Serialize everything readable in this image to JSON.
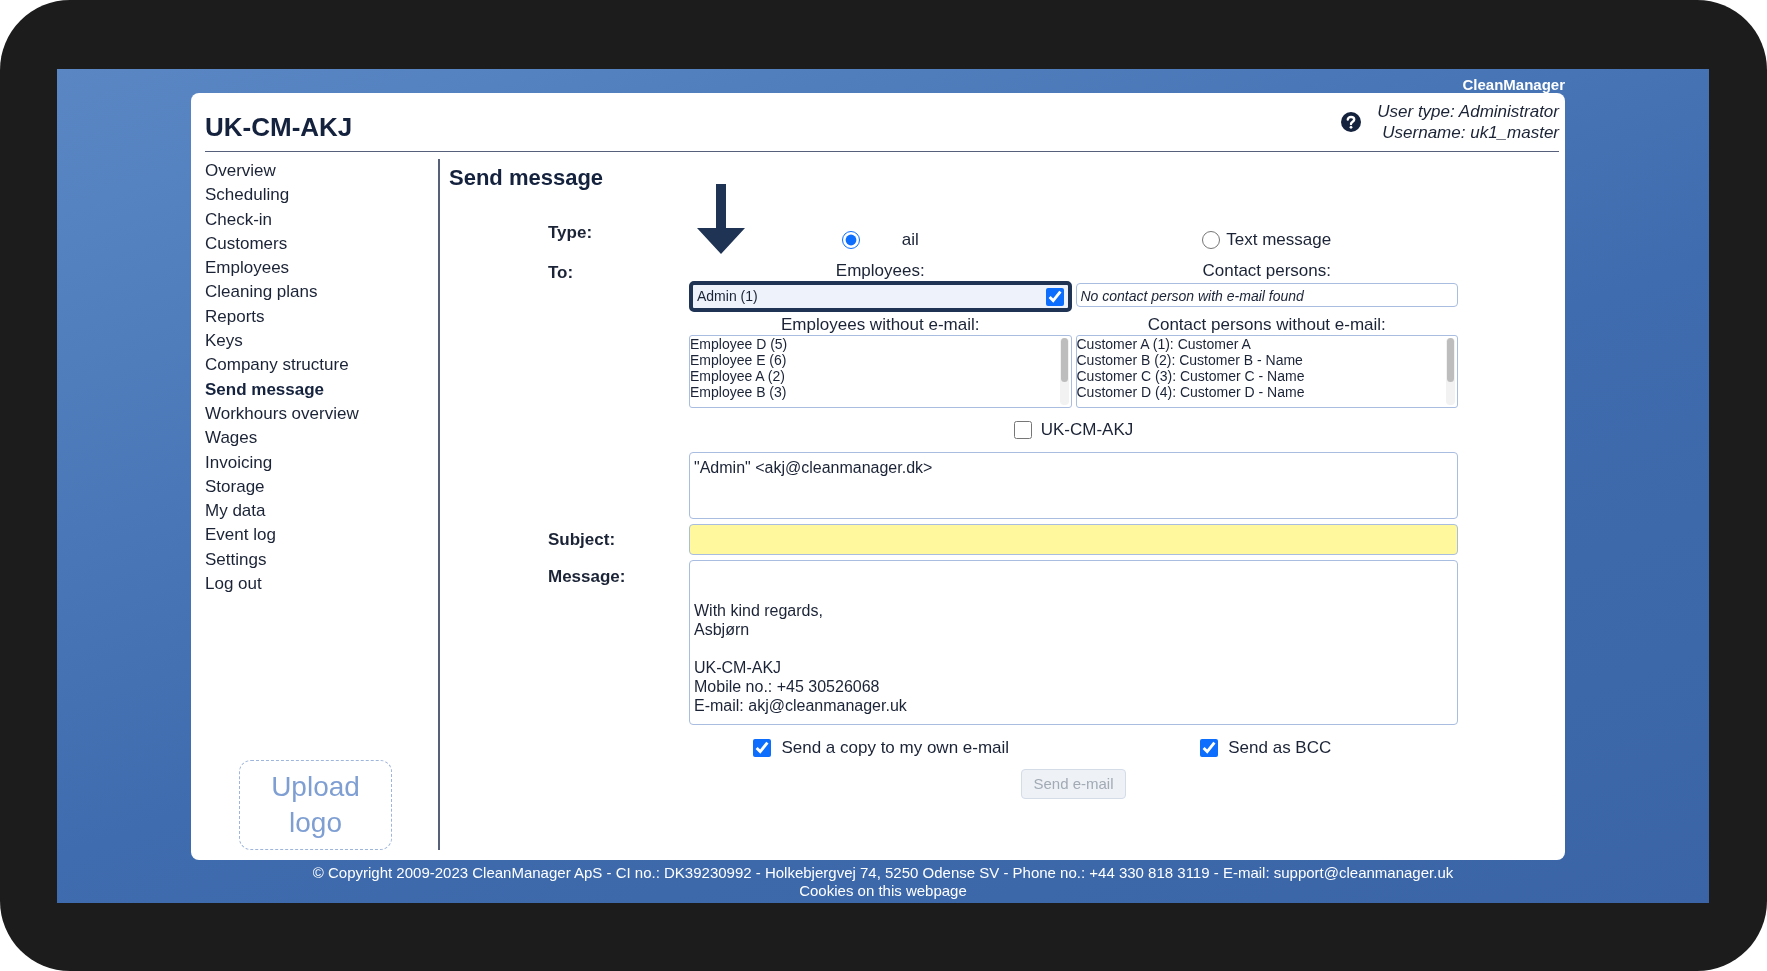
{
  "app_title": "CleanManager",
  "header": {
    "title": "UK-CM-AKJ",
    "user_type": "User type: Administrator",
    "username": "Username: uk1_master"
  },
  "sidebar": {
    "items": [
      {
        "label": "Overview",
        "selected": false
      },
      {
        "label": "Scheduling",
        "selected": false
      },
      {
        "label": "Check-in",
        "selected": false
      },
      {
        "label": "Customers",
        "selected": false
      },
      {
        "label": "Employees",
        "selected": false
      },
      {
        "label": "Cleaning plans",
        "selected": false
      },
      {
        "label": "Reports",
        "selected": false
      },
      {
        "label": "Keys",
        "selected": false
      },
      {
        "label": "Company structure",
        "selected": false
      },
      {
        "label": "Send message",
        "selected": true
      },
      {
        "label": "Workhours overview",
        "selected": false
      },
      {
        "label": "Wages",
        "selected": false
      },
      {
        "label": "Invoicing",
        "selected": false
      },
      {
        "label": "Storage",
        "selected": false
      },
      {
        "label": "My data",
        "selected": false
      },
      {
        "label": "Event log",
        "selected": false
      },
      {
        "label": "Settings",
        "selected": false
      },
      {
        "label": "Log out",
        "selected": false
      }
    ],
    "upload_logo": "Upload logo"
  },
  "page_title": "Send message",
  "form": {
    "type_label": "Type:",
    "type_options": [
      {
        "label": "ail",
        "selected": true
      },
      {
        "label": "Text message",
        "selected": false
      }
    ],
    "to_label": "To:",
    "employees_heading": "Employees:",
    "employees": [
      {
        "label": "Admin (1)",
        "checked": true,
        "highlighted": true
      }
    ],
    "contacts_heading": "Contact persons:",
    "contacts_empty": "No contact person with e-mail found",
    "employees_without_heading": "Employees without e-mail:",
    "employees_without": [
      "Employee D (5)",
      "Employee E (6)",
      "Employee A (2)",
      "Employee B (3)"
    ],
    "contacts_without_heading": "Contact persons without e-mail:",
    "contacts_without": [
      "Customer A (1): Customer A",
      "Customer B (2): Customer B - Name",
      "Customer C (3): Customer C - Name",
      "Customer D (4): Customer D - Name"
    ],
    "company_checkbox": {
      "label": "UK-CM-AKJ",
      "checked": false
    },
    "recipients": "\"Admin\" <akj@cleanmanager.dk>",
    "subject_label": "Subject:",
    "message_label": "Message:",
    "message": "\n\nWith kind regards,\nAsbjørn\n\nUK-CM-AKJ\nMobile no.: +45 30526068\nE-mail: akj@cleanmanager.uk",
    "options": [
      {
        "label": "Send a copy to my own e-mail",
        "checked": true
      },
      {
        "label": "Send as BCC",
        "checked": true
      }
    ],
    "send_button": {
      "label": "Send e-mail",
      "disabled": true
    }
  },
  "annotations": [
    {
      "kind": "arrow"
    }
  ],
  "footer": {
    "copyright": "© Copyright 2009-2023 CleanManager ApS - CI no.: DK39230992 - Holkebjergvej 74, 5250 Odense SV - Phone no.: +44 330 818 3119 - E-mail: support@cleanmanager.uk",
    "cookies": "Cookies on this webpage"
  }
}
